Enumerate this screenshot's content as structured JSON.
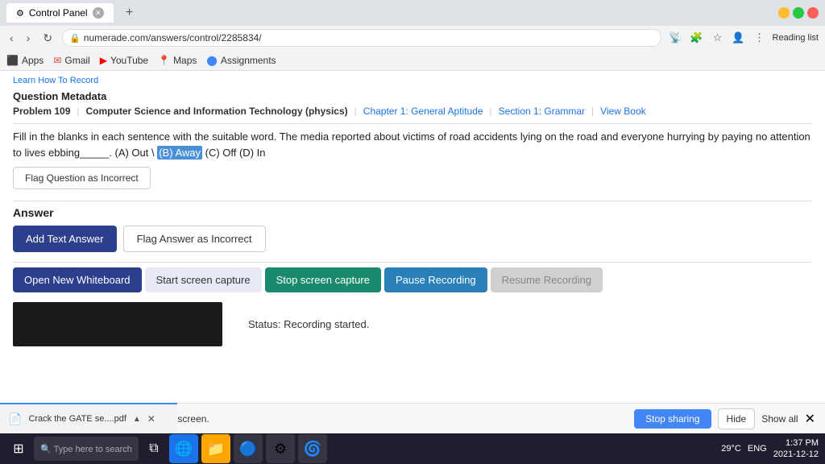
{
  "browser": {
    "tab_title": "Control Panel",
    "url": "numerade.com/answers/control/2285834/",
    "url_display": "numerade.com/answers/control/2285834/",
    "reading_list": "Reading list"
  },
  "bookmarks": {
    "items": [
      {
        "label": "Apps",
        "icon": "⬛"
      },
      {
        "label": "Gmail",
        "icon": "✉"
      },
      {
        "label": "YouTube",
        "icon": "▶"
      },
      {
        "label": "Maps",
        "icon": "📍"
      },
      {
        "label": "Assignments",
        "icon": "🔵"
      }
    ]
  },
  "page": {
    "learn_link": "Learn How To Record",
    "metadata": {
      "title": "Question Metadata",
      "problem": "Problem 109",
      "subject": "Computer Science and Information Technology (physics)",
      "chapter": "Chapter 1: General Aptitude",
      "section": "Section 1: Grammar",
      "view_book": "View Book"
    },
    "question": {
      "text": "Fill in the blanks in each sentence with the suitable word. The media reported about victims of road accidents lying on the road and everyone hurrying by paying no attention to lives ebbing_____. (A) Out \\",
      "highlight": "(B) Away",
      "text_after": "(C) Off (D) In"
    },
    "flag_question_btn": "Flag Question as Incorrect",
    "answer_section": {
      "label": "Answer",
      "add_text_btn": "Add Text Answer",
      "flag_answer_btn": "Flag Answer as Incorrect"
    },
    "action_buttons": {
      "open_whiteboard": "Open New Whiteboard",
      "start_screen": "Start screen capture",
      "stop_screen": "Stop screen capture",
      "pause_recording": "Pause Recording",
      "resume_recording": "Resume Recording"
    },
    "status": "Status: Recording started."
  },
  "sharing_bar": {
    "icon": "⏸",
    "text": "www.numerade.com is sharing your screen.",
    "stop_btn": "Stop sharing",
    "hide_btn": "Hide"
  },
  "downloads": {
    "filename": "Crack the GATE se....pdf",
    "show_all": "Show all",
    "close": "✕"
  },
  "taskbar": {
    "time": "1:37 PM",
    "date": "2021-12-12",
    "weather": "29°C",
    "lang": "ENG"
  }
}
